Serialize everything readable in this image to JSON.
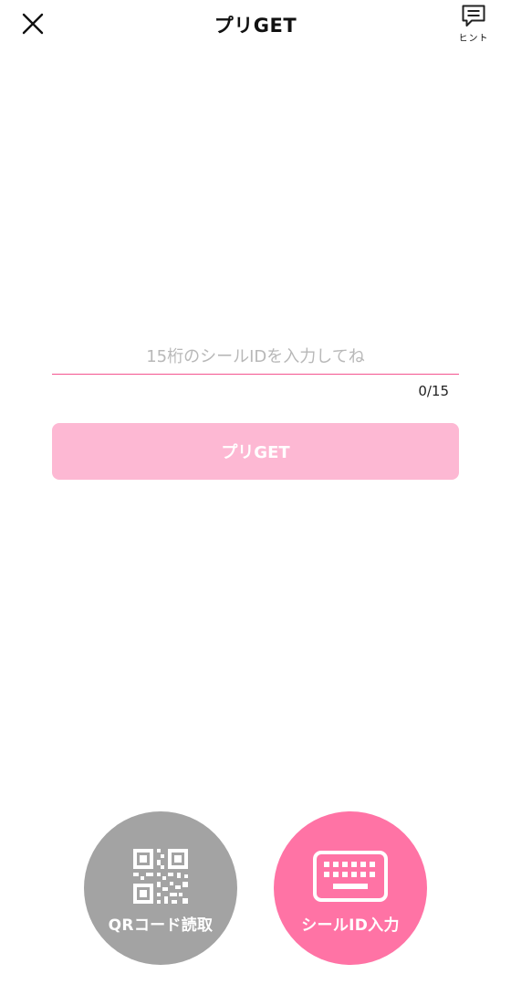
{
  "header": {
    "title": "プリGET",
    "hint_label": "ヒント"
  },
  "form": {
    "placeholder": "15桁のシールIDを入力してね",
    "value": "",
    "counter": "0/15",
    "submit_label": "プリGET"
  },
  "modes": {
    "qr_label": "QRコード読取",
    "id_label": "シールID入力"
  },
  "colors": {
    "accent": "#ff73a5",
    "button_disabled": "#fdb8d3",
    "qr_circle": "#a3a3a3",
    "input_underline": "#f4548f"
  },
  "icons": {
    "close": "close-icon",
    "hint": "chat-bubble-icon",
    "qr": "qr-code-icon",
    "keyboard": "keyboard-icon"
  }
}
